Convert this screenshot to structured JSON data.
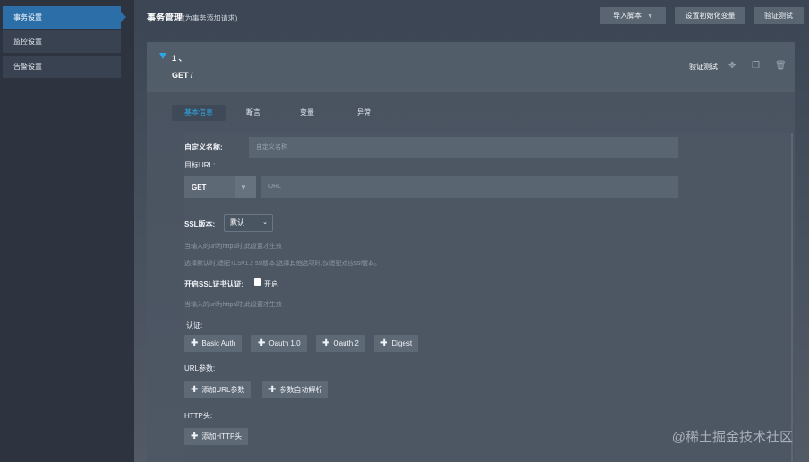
{
  "sidebar": {
    "items": [
      {
        "label": "事务设置"
      },
      {
        "label": "监控设置"
      },
      {
        "label": "告警设置"
      }
    ]
  },
  "header": {
    "title": "事务管理",
    "subtitle": "(为事务添加请求)",
    "import_label": "导入脚本",
    "init_vars_label": "设置初始化变量",
    "verify_label": "验证测试"
  },
  "card": {
    "number": "1 、",
    "method_path": "GET /",
    "verify_label": "验证测试"
  },
  "tabs": [
    {
      "label": "基本信息"
    },
    {
      "label": "断言"
    },
    {
      "label": "变量"
    },
    {
      "label": "异常"
    }
  ],
  "form": {
    "custom_name_label": "自定义名称:",
    "custom_name_placeholder": "自定义名称",
    "target_url_label": "目标URL:",
    "method_value": "GET",
    "url_placeholder": "URL",
    "ssl_version_label": "SSL版本:",
    "ssl_version_value": "默认",
    "ssl_hint_1": "当输入的url为https时,此设置才生效",
    "ssl_hint_2": "选择默认时,适配TLSv1.2 ssl版本;选择其他选项时,仅适配对应ssl版本。",
    "ssl_cert_label": "开启SSL证书认证:",
    "ssl_cert_option": "开启",
    "ssl_cert_hint": "当输入的url为https时,此设置才生效",
    "auth_label": "认证:",
    "auth_buttons": [
      "Basic Auth",
      "Oauth 1.0",
      "Oauth 2",
      "Digest"
    ],
    "url_params_label": "URL参数:",
    "add_url_param": "添加URL参数",
    "auto_parse_params": "参数自动解析",
    "http_header_label": "HTTP头:",
    "add_http_header": "添加HTTP头"
  },
  "watermark": "@稀土掘金技术社区"
}
